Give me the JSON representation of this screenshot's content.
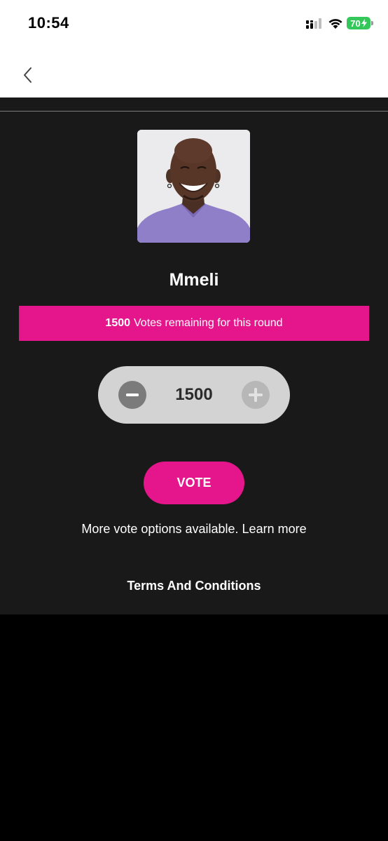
{
  "status_bar": {
    "time": "10:54",
    "battery_level": "70",
    "icons": [
      "cellular-signal-icon",
      "wifi-icon",
      "battery-charging-icon"
    ]
  },
  "nav": {
    "back_icon": "chevron-left-icon"
  },
  "contestant": {
    "name": "Mmeli"
  },
  "votes_banner": {
    "count": "1500",
    "text": "Votes remaining for this round"
  },
  "stepper": {
    "value": "1500",
    "minus_icon": "minus-icon",
    "plus_icon": "plus-icon"
  },
  "vote_button": {
    "label": "VOTE"
  },
  "more_options": {
    "text": "More vote options available.",
    "link": "Learn more"
  },
  "terms": {
    "label": "Terms And Conditions"
  },
  "colors": {
    "accent": "#e5168c",
    "panel_background": "#1a191a",
    "page_background": "#000000",
    "stepper_background": "#d3d3d3",
    "battery": "#34c759"
  }
}
